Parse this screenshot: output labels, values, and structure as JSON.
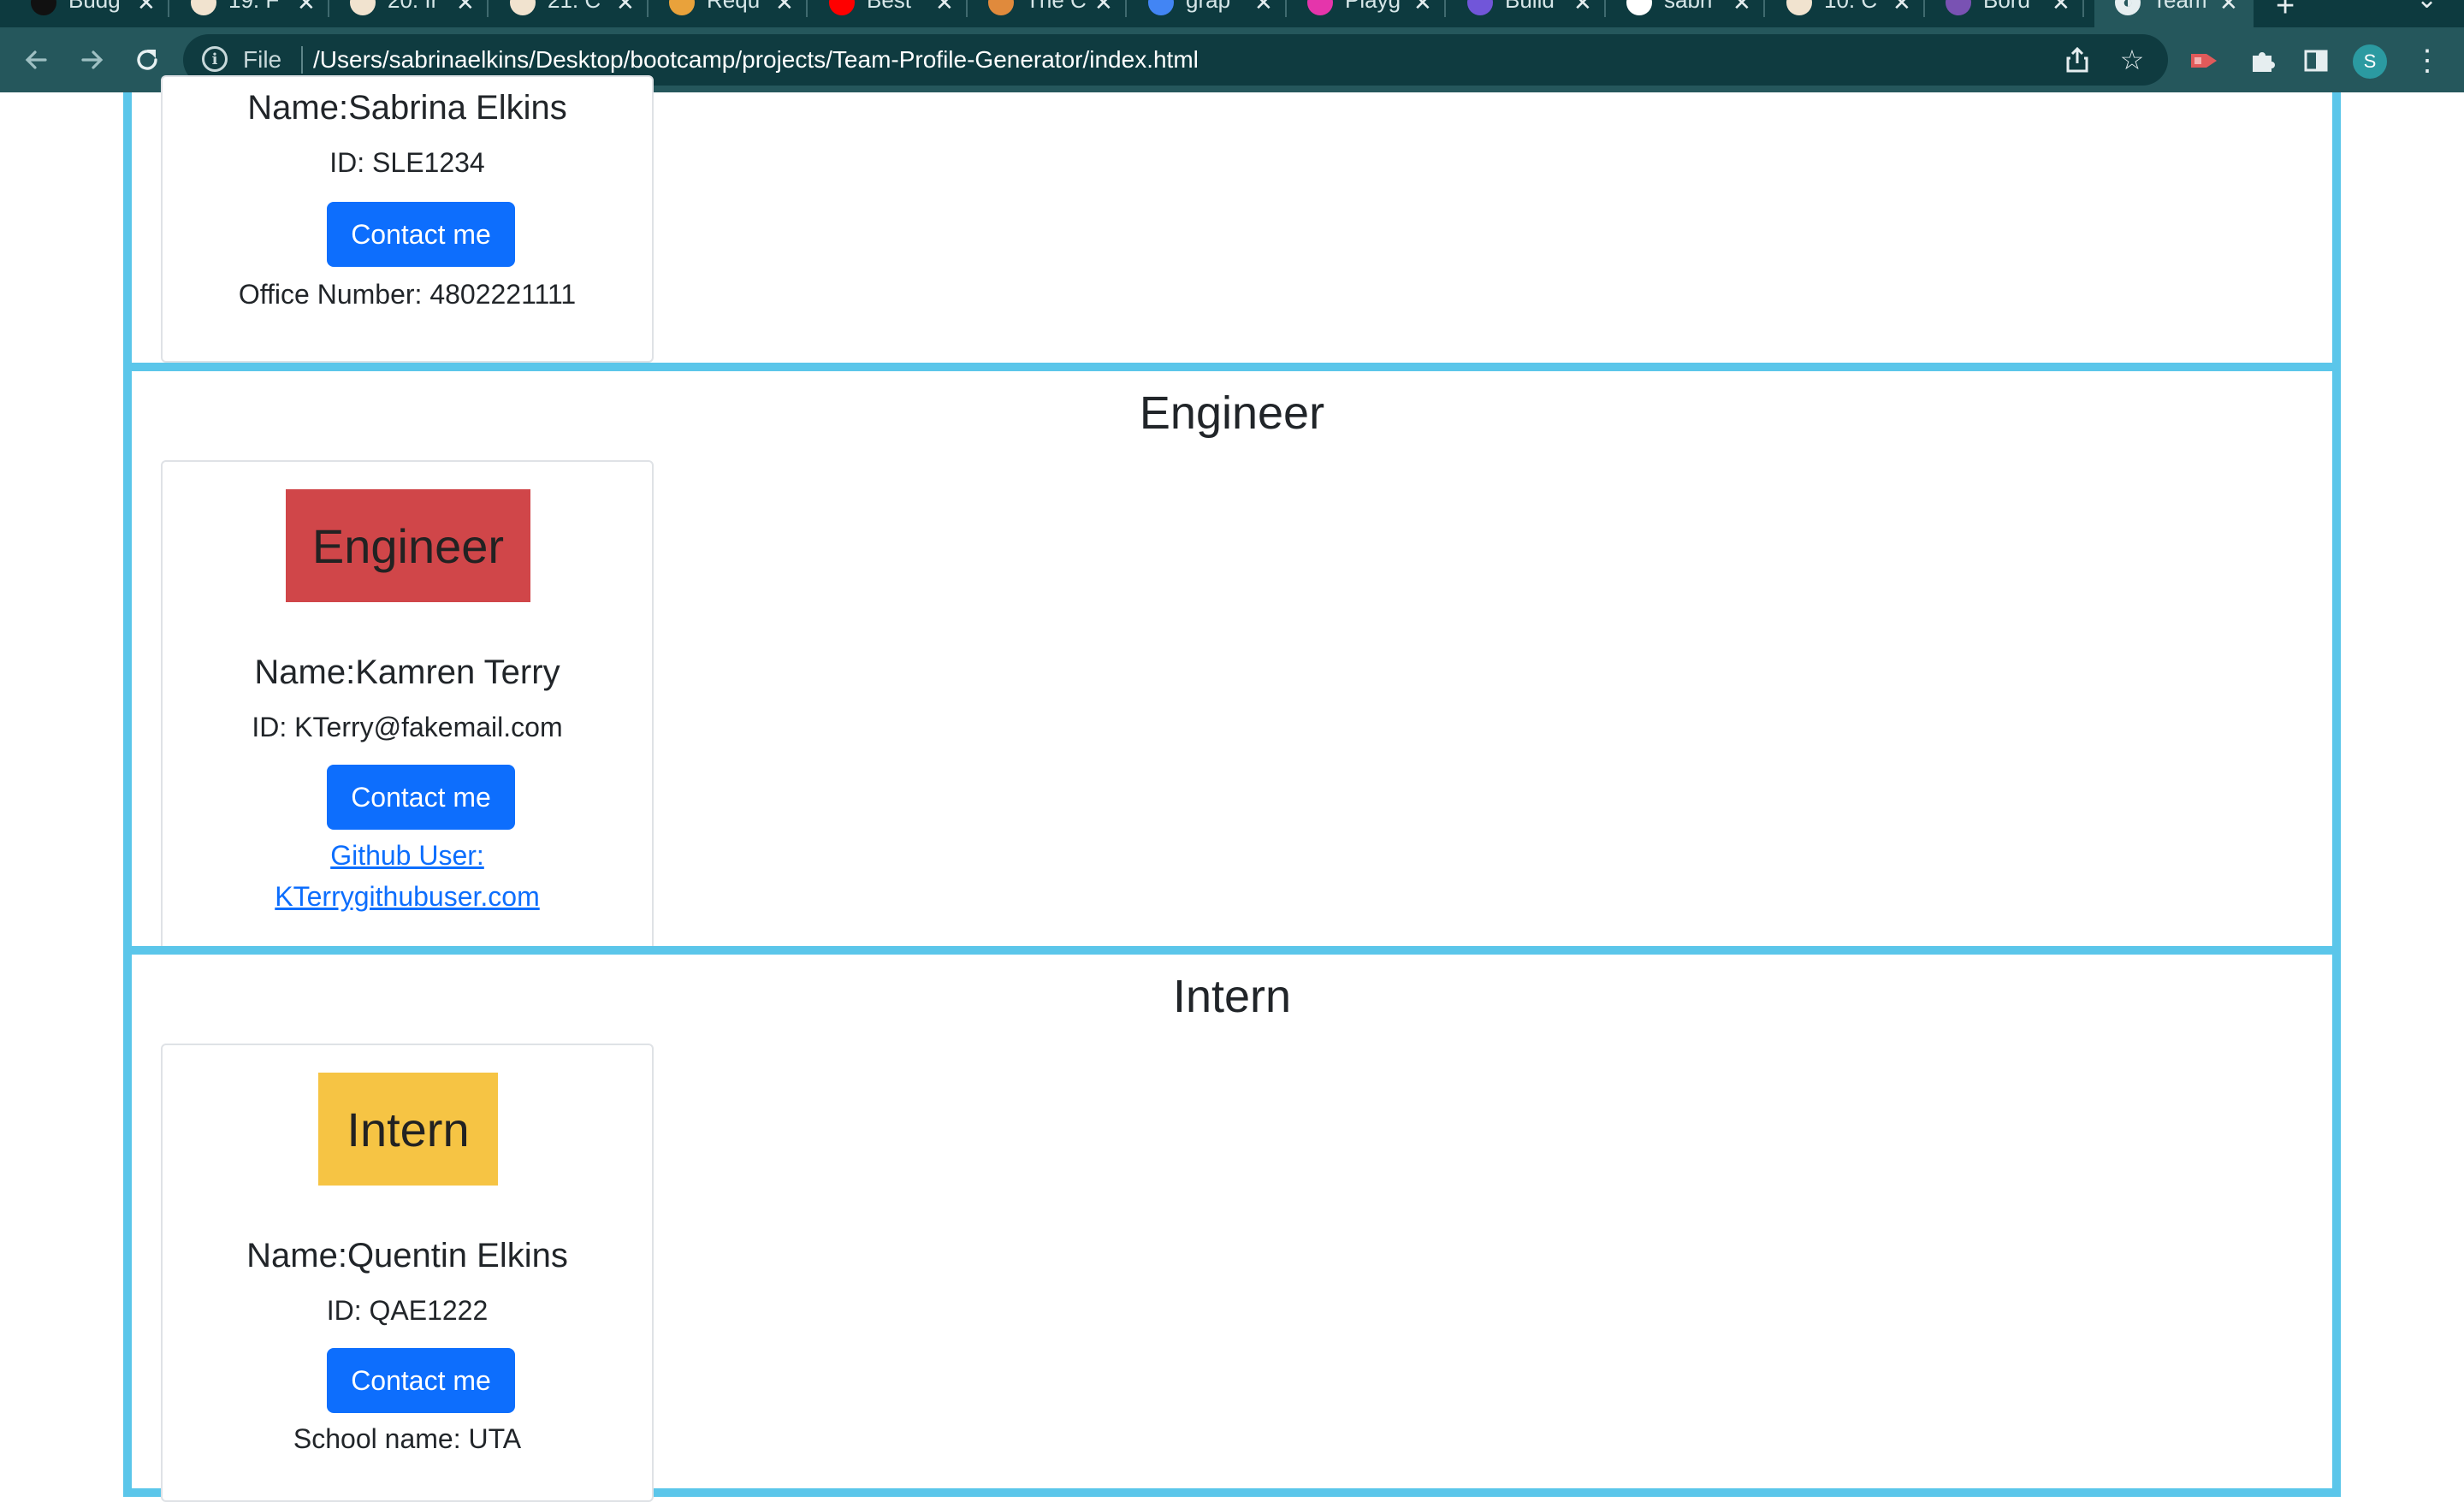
{
  "browser": {
    "tabs": [
      {
        "title": "Budg",
        "icon": "budget-icon",
        "color": "#111111"
      },
      {
        "title": "19. F",
        "icon": "bootcamp-icon",
        "color": "#f1e3cf"
      },
      {
        "title": "20. Ir",
        "icon": "bootcamp-icon",
        "color": "#f1e3cf"
      },
      {
        "title": "21. C",
        "icon": "bootcamp-icon",
        "color": "#f1e3cf"
      },
      {
        "title": "Requ",
        "icon": "js-icon",
        "color": "#e9a23b"
      },
      {
        "title": "Best",
        "icon": "youtube-icon",
        "color": "#ff0000"
      },
      {
        "title": "The C",
        "icon": "swirl-icon",
        "color": "#e08a3c"
      },
      {
        "title": "grap",
        "icon": "google-icon",
        "color": "#4285f4"
      },
      {
        "title": "Playg",
        "icon": "graphql-icon",
        "color": "#e535ab"
      },
      {
        "title": "Build",
        "icon": "apollo-icon",
        "color": "#7156d9"
      },
      {
        "title": "sabri",
        "icon": "github-icon",
        "color": "#ffffff"
      },
      {
        "title": "10. C",
        "icon": "bootcamp-icon",
        "color": "#f1e3cf"
      },
      {
        "title": "Bord",
        "icon": "bootstrap-icon",
        "color": "#7952b3"
      }
    ],
    "active_tab": {
      "title": "Team",
      "icon": "globe-icon"
    },
    "close_glyph": "✕",
    "new_tab_glyph": "+",
    "scheme": "File",
    "url": "/Users/sabrinaelkins/Desktop/bootcamp/projects/Team-Profile-Generator/index.html",
    "profile_initial": "S"
  },
  "colors": {
    "section_border": "#5bc6ea",
    "primary_button": "#0d6efd",
    "engineer_badge": "#d04649",
    "intern_badge": "#f6c444"
  },
  "manager": {
    "name": "Name:Sabrina Elkins",
    "id": "ID: SLE1234",
    "contact": "Contact me",
    "office": "Office Number: 4802221111"
  },
  "engineer": {
    "heading": "Engineer",
    "badge": "Engineer",
    "name": "Name:Kamren Terry",
    "id": "ID: KTerry@fakemail.com",
    "contact": "Contact me",
    "github_line1": "Github User:",
    "github_line2": "KTerrygithubuser.com"
  },
  "intern": {
    "heading": "Intern",
    "badge": "Intern",
    "name": "Name:Quentin Elkins",
    "id": "ID: QAE1222",
    "contact": "Contact me",
    "school": "School name: UTA"
  }
}
